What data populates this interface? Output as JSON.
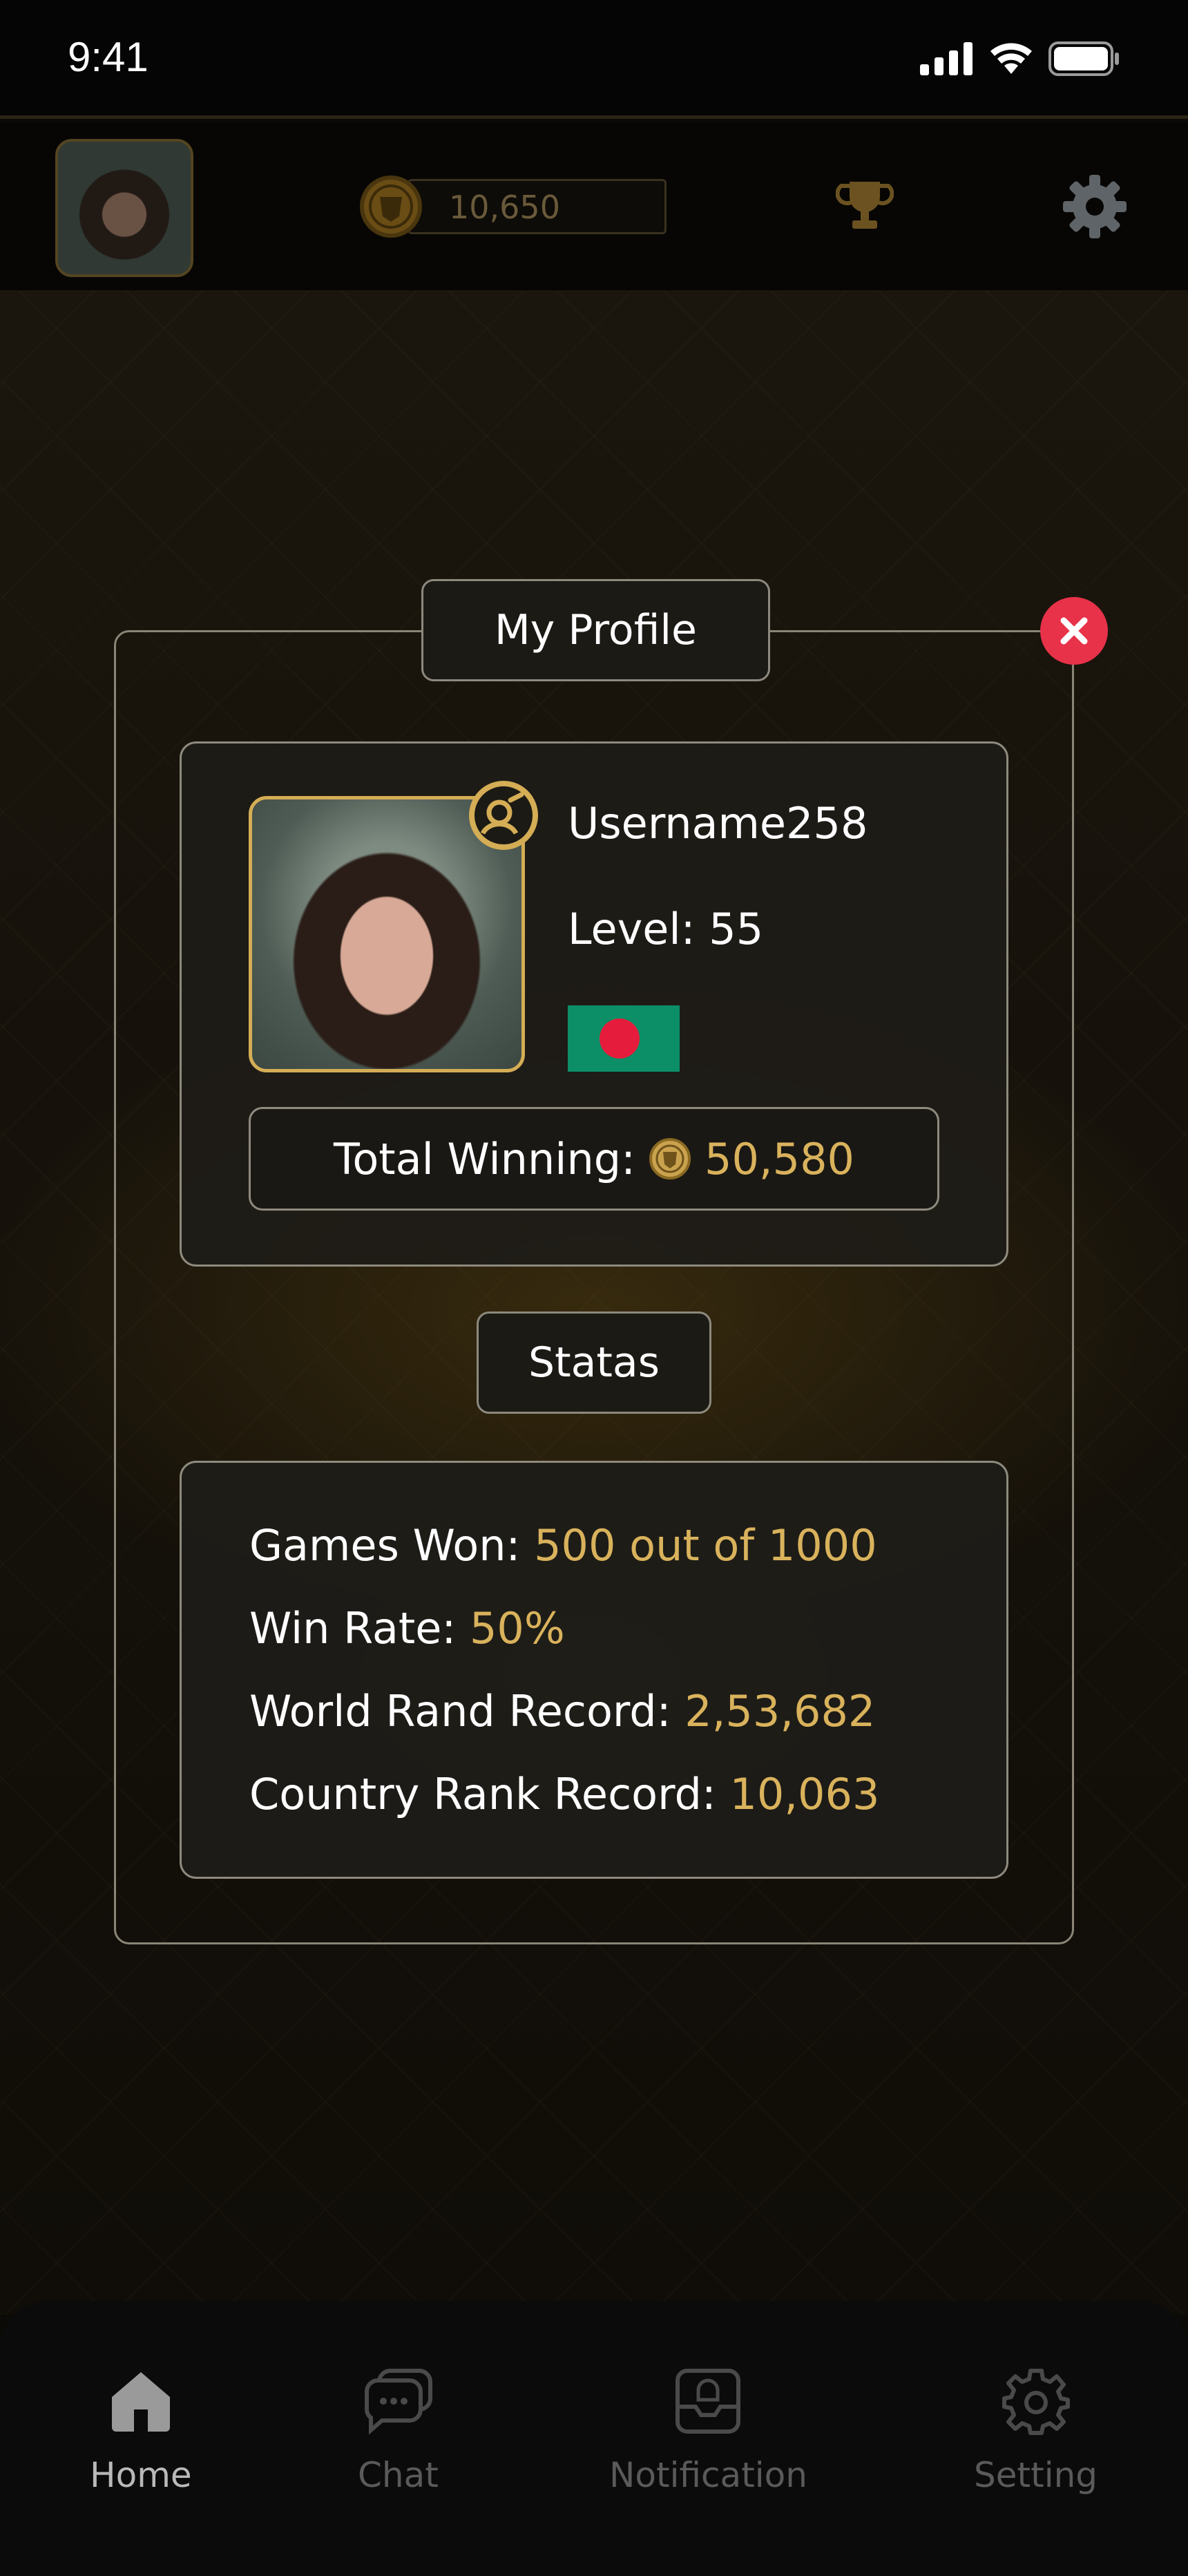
{
  "status_bar": {
    "time": "9:41"
  },
  "header": {
    "coins": "10,650"
  },
  "dialog": {
    "title": "My Profile",
    "profile": {
      "username": "Username258",
      "level": "Level: 55",
      "total_winning_label": "Total Winning:",
      "total_winning_value": "50,580"
    },
    "stats_title": "Statas",
    "stats": [
      {
        "label": "Games Won:",
        "value": "500 out of 1000"
      },
      {
        "label": "Win Rate:",
        "value": "50%"
      },
      {
        "label": "World Rand Record:",
        "value": "2,53,682"
      },
      {
        "label": "Country Rank Record:",
        "value": "10,063"
      }
    ]
  },
  "bottom_nav": [
    {
      "label": "Home",
      "icon": "home-icon",
      "active": true
    },
    {
      "label": "Chat",
      "icon": "chat-icon",
      "active": false
    },
    {
      "label": "Notification",
      "icon": "notification-icon",
      "active": false
    },
    {
      "label": "Setting",
      "icon": "gear-icon",
      "active": false
    }
  ],
  "colors": {
    "accent_gold": "#d9b25c",
    "close_red": "#e8324a",
    "flag_green": "#0c8f66",
    "flag_red": "#e61c3c"
  }
}
